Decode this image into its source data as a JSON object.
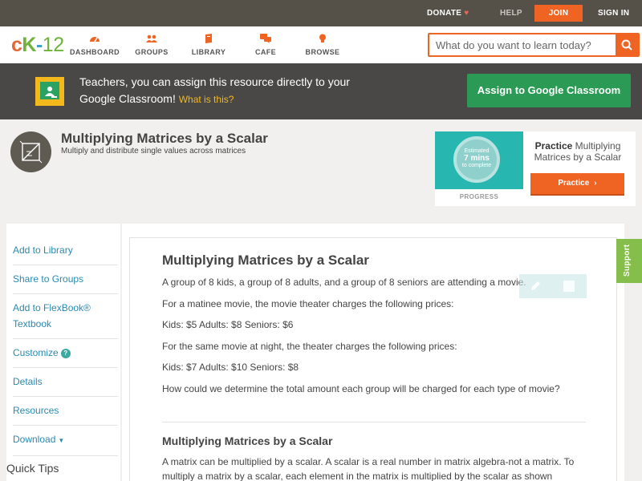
{
  "topbar": {
    "donate": "DONATE",
    "help": "HELP",
    "join": "JOIN",
    "signin": "SIGN IN"
  },
  "nav": {
    "logo": {
      "c": "c",
      "k": "K",
      "dash": "-",
      "num": "12"
    },
    "items": [
      {
        "label": "DASHBOARD",
        "icon": "dashboard-gauge-icon"
      },
      {
        "label": "GROUPS",
        "icon": "groups-people-icon"
      },
      {
        "label": "LIBRARY",
        "icon": "library-book-icon"
      },
      {
        "label": "CAFE",
        "icon": "cafe-chat-icon"
      },
      {
        "label": "BROWSE",
        "icon": "browse-bulb-icon"
      }
    ],
    "search_placeholder": "What do you want to learn today?"
  },
  "banner": {
    "text": "Teachers, you can assign this resource directly to your Google Classroom!",
    "what": "What is this?",
    "assign_button": "Assign to Google Classroom"
  },
  "concept": {
    "title": "Multiplying Matrices by a Scalar",
    "subtitle": "Multiply and distribute single values across matrices"
  },
  "practice": {
    "estimated": "Estimated",
    "mins": "7 mins",
    "to_complete": "to complete",
    "progress": "PROGRESS",
    "title_bold": "Practice",
    "title_rest": "Multiplying Matrices by a Scalar",
    "button": "Practice"
  },
  "sidebar": {
    "items": [
      {
        "label": "Add to Library"
      },
      {
        "label": "Share to Groups"
      },
      {
        "label": "Add to FlexBook® Textbook"
      },
      {
        "label": "Customize"
      },
      {
        "label": "Details"
      },
      {
        "label": "Resources"
      },
      {
        "label": "Download"
      }
    ],
    "quick_tips": "Quick Tips"
  },
  "content": {
    "heading": "Multiplying Matrices by a Scalar",
    "paragraphs": [
      "A group of 8 kids, a group of 8 adults, and a group of 8 seniors are attending a movie.",
      "For a matinee movie, the movie theater charges the following prices:",
      "Kids: $5 Adults: $8 Seniors: $6",
      "For the same movie at night, the theater charges the following prices:",
      "Kids: $7 Adults: $10 Seniors: $8",
      "How could we determine the total amount each group will be charged for each type of movie?"
    ],
    "subheading": "Multiplying Matrices by a Scalar",
    "body": [
      "A matrix can be multiplied by a scalar. A scalar is a real number in matrix algebra-not a matrix. To",
      "multiply a matrix by a scalar, each element in the matrix is multiplied by the scalar as shown"
    ]
  },
  "support": "Support",
  "colors": {
    "accent_orange": "#ef6423",
    "google_green": "#2a9a55",
    "link_blue": "#2a8ab0",
    "support_green": "#85be4b"
  }
}
